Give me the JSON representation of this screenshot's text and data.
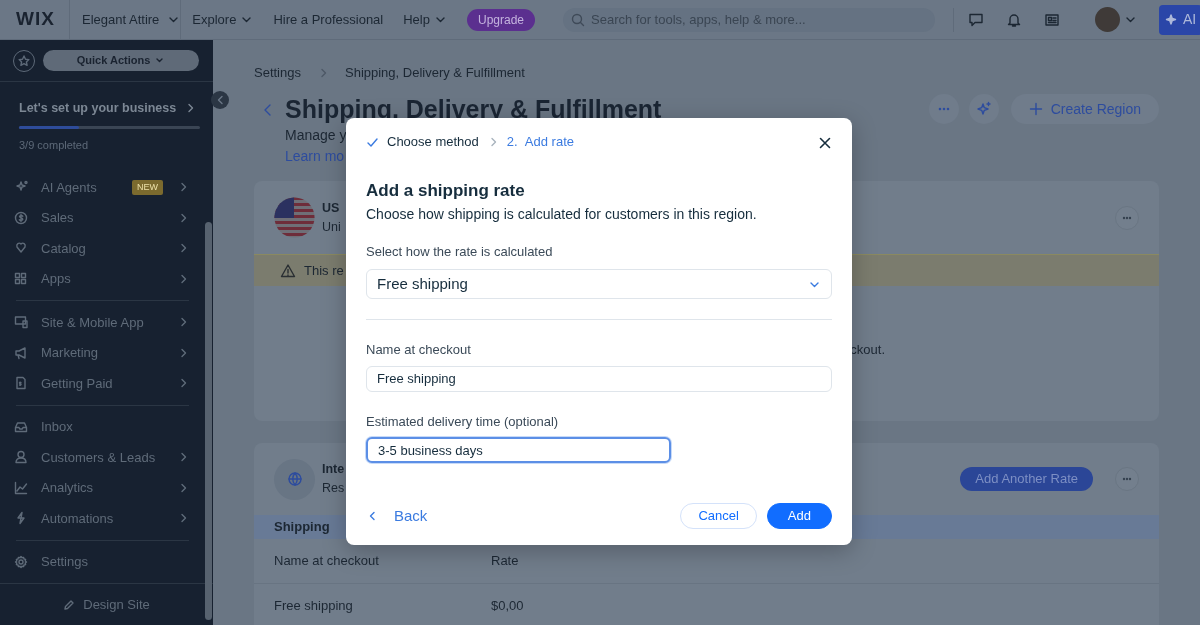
{
  "topbar": {
    "logo": "WIX",
    "site_name": "Elegant Attire",
    "menu": [
      {
        "label": "Explore",
        "dropdown": true
      },
      {
        "label": "Hire a Professional",
        "dropdown": false
      },
      {
        "label": "Help",
        "dropdown": true
      }
    ],
    "upgrade": "Upgrade",
    "search": {
      "placeholder": "Search for tools, apps, help & more..."
    },
    "ai_button": "AI"
  },
  "sidebar": {
    "quick_actions": "Quick Actions",
    "setup": {
      "title": "Let's set up your business",
      "level": 0.33,
      "progress_text": "3/9 completed"
    },
    "groups": [
      [
        {
          "label": "AI Agents",
          "badge": "NEW",
          "chevron": true
        },
        {
          "label": "Sales",
          "chevron": true
        },
        {
          "label": "Catalog",
          "chevron": true
        },
        {
          "label": "Apps",
          "chevron": true
        }
      ],
      [
        {
          "label": "Site & Mobile App",
          "chevron": true
        },
        {
          "label": "Marketing",
          "chevron": true
        },
        {
          "label": "Getting Paid",
          "chevron": true
        }
      ],
      [
        {
          "label": "Inbox",
          "chevron": false
        },
        {
          "label": "Customers & Leads",
          "chevron": true
        },
        {
          "label": "Analytics",
          "chevron": true
        },
        {
          "label": "Automations",
          "chevron": true
        }
      ],
      [
        {
          "label": "Settings",
          "chevron": false
        }
      ]
    ],
    "footer": "Design Site"
  },
  "page": {
    "breadcrumb": [
      "Settings",
      "Shipping, Delivery & Fulfillment"
    ],
    "title": "Shipping, Delivery & Fulfillment",
    "subtitle": "Manage y",
    "link": "Learn mo",
    "create_button": "Create Region"
  },
  "regions": [
    {
      "kind": "country",
      "name": "US",
      "subtitle": "Uni",
      "warning": "This re",
      "note": "ckout."
    },
    {
      "kind": "international",
      "name": "Inte",
      "subtitle": "Res",
      "button": "Add Another Rate",
      "table": {
        "section": "Shipping",
        "columns": [
          "Name at checkout",
          "Rate"
        ],
        "rows": [
          [
            "Free shipping",
            "$0,00"
          ]
        ]
      }
    }
  ],
  "dialog": {
    "steps": [
      {
        "label": "Choose method",
        "done": true,
        "selected": false
      },
      {
        "number": "2.",
        "label": "Add rate",
        "done": false,
        "selected": true
      }
    ],
    "title": "Add a shipping rate",
    "description": "Choose how shipping is calculated for customers in this region.",
    "fields": [
      {
        "kind": "select",
        "label": "Select how the rate is calculated",
        "value": "Free shipping",
        "focused": false
      },
      {
        "kind": "text",
        "label": "Name at checkout",
        "value": "Free shipping",
        "focused": false
      },
      {
        "kind": "text",
        "label": "Estimated delivery time (optional)",
        "value": "3-5 business days",
        "focused": true
      }
    ],
    "back": "Back",
    "cancel": "Cancel",
    "add": "Add"
  }
}
